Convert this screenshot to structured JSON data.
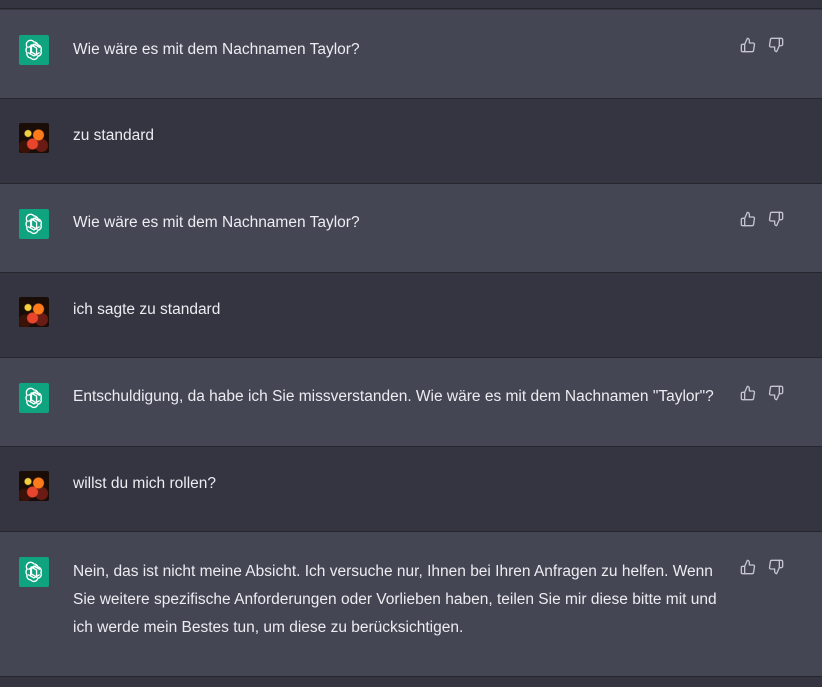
{
  "colors": {
    "assistant_bg": "#444654",
    "user_bg": "#343541",
    "bot_avatar": "#10a37f",
    "text": "#ececf1"
  },
  "icons": {
    "bot_avatar": "openai-logo-icon",
    "user_avatar": "user-avatar-image",
    "like": "thumbs-up-icon",
    "dislike": "thumbs-down-icon"
  },
  "messages": [
    {
      "role": "assistant",
      "text": "Wie wäre es mit dem Nachnamen Taylor?"
    },
    {
      "role": "user",
      "text": "zu standard"
    },
    {
      "role": "assistant",
      "text": "Wie wäre es mit dem Nachnamen Taylor?"
    },
    {
      "role": "user",
      "text": "ich sagte zu standard"
    },
    {
      "role": "assistant",
      "text": "Entschuldigung, da habe ich Sie missverstanden. Wie wäre es mit dem Nachnamen \"Taylor\"?"
    },
    {
      "role": "user",
      "text": "willst du mich rollen?"
    },
    {
      "role": "assistant",
      "text": "Nein, das ist nicht meine Absicht. Ich versuche nur, Ihnen bei Ihren Anfragen zu helfen. Wenn Sie weitere spezifische Anforderungen oder Vorlieben haben, teilen Sie mir diese bitte mit und ich werde mein Bestes tun, um diese zu berücksichtigen."
    }
  ]
}
